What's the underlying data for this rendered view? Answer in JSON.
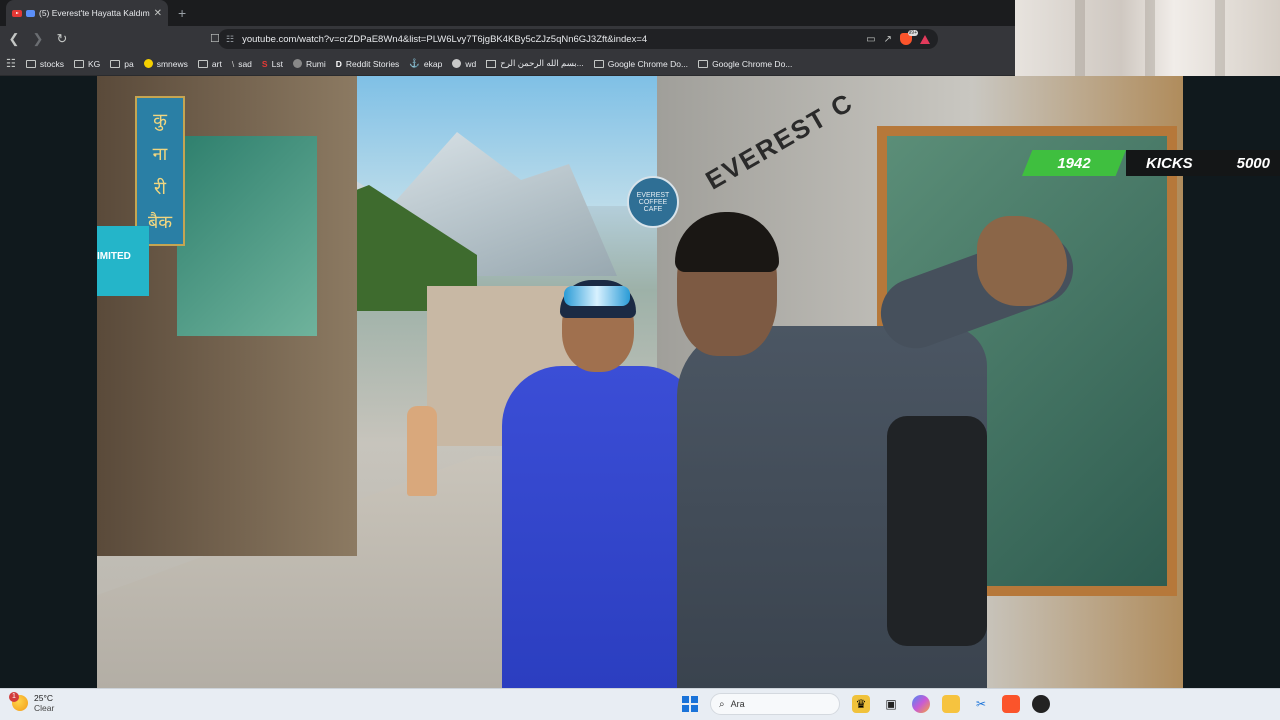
{
  "browser": {
    "tab_title": "(5) Everest'te Hayatta Kaldım",
    "close_glyph": "✕",
    "new_tab_glyph": "+",
    "url": "youtube.com/watch?v=crZDPaE8Wn4&list=PLW6Lvy7T6jgBK4KBy5cZJz5qNn6GJ3Zft&index=4",
    "brave_badge": "99+"
  },
  "bookmarks": [
    {
      "label": "stocks",
      "icon": "folder-icon"
    },
    {
      "label": "KG",
      "icon": "folder-icon"
    },
    {
      "label": "pa",
      "icon": "folder-icon"
    },
    {
      "label": "smnews",
      "icon": "smiley-icon"
    },
    {
      "label": "art",
      "icon": "folder-icon"
    },
    {
      "label": "sad",
      "icon": "slash-icon"
    },
    {
      "label": "Lst",
      "icon": "s-icon"
    },
    {
      "label": "Rumi",
      "icon": "globe-icon"
    },
    {
      "label": "Reddit Stories",
      "icon": "d-icon"
    },
    {
      "label": "ekap",
      "icon": "bird-icon"
    },
    {
      "label": "wd",
      "icon": "wiki-icon"
    },
    {
      "label": "بسم الله الرحمن الرح...",
      "icon": "doc-icon"
    },
    {
      "label": "Google Chrome Do...",
      "icon": "folder-icon"
    },
    {
      "label": "Google Chrome Do...",
      "icon": "folder-icon"
    }
  ],
  "video": {
    "sign_devanagari": [
      "कु",
      "ना",
      "री",
      "बैक"
    ],
    "sign_cyan": "IMITED",
    "cafe_text": "EVEREST COFFEE CAFE",
    "everest_sign": "EVEREST C"
  },
  "overlay": {
    "count": "1942",
    "label": "KICKS",
    "goal": "5000",
    "count_color": "#3fbf3f"
  },
  "taskbar": {
    "weather_temp": "25°C",
    "weather_desc": "Clear",
    "weather_badge": "1",
    "search_placeholder": "Ara",
    "apps": [
      "widgets-icon",
      "task-view-icon",
      "copilot-icon",
      "file-explorer-icon",
      "snipping-tool-icon",
      "brave-browser-icon",
      "obs-icon"
    ]
  }
}
